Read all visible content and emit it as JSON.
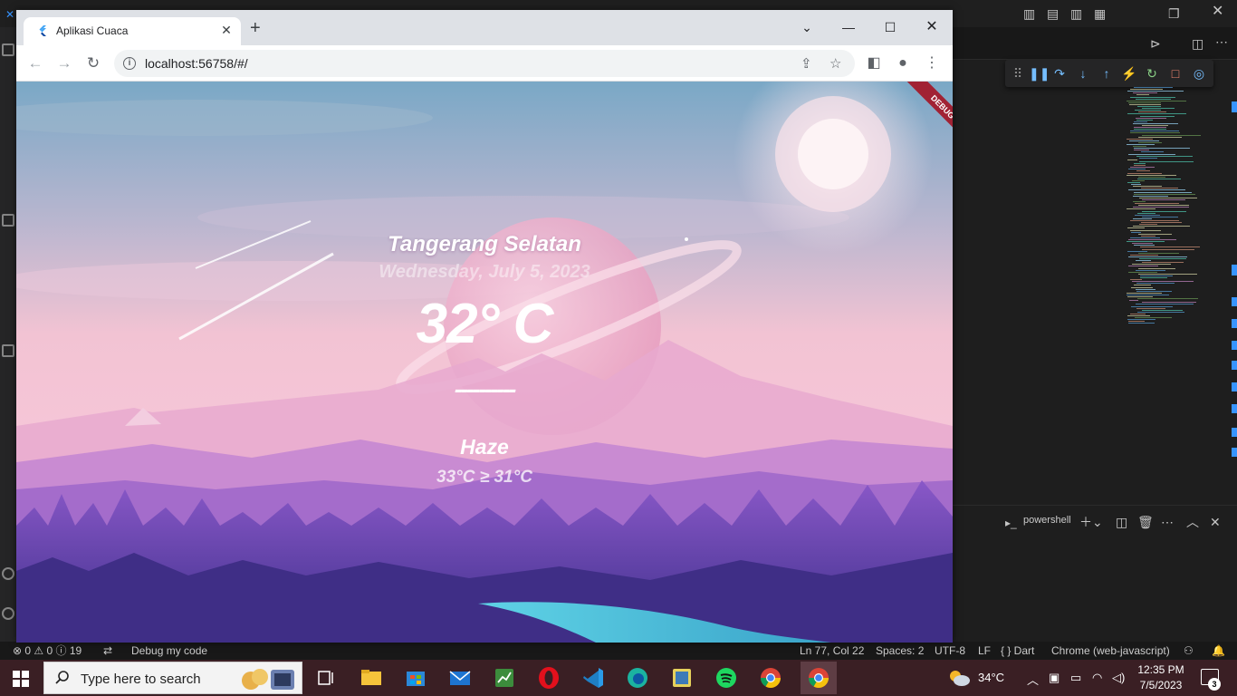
{
  "browser": {
    "tab_title": "Aplikasi Cuaca",
    "url": "localhost:56758/#/"
  },
  "weather": {
    "city": "Tangerang Selatan",
    "date": "Wednesday, July 5, 2023",
    "temperature": "32° C",
    "divider": "----------",
    "condition": "Haze",
    "range": "33°C ≥ 31°C",
    "debug_banner": "DEBUG"
  },
  "vscode": {
    "terminal_label": "powershell",
    "status": {
      "problems": "⊗ 0 ⚠ 0 ⓘ 19",
      "debug_target": "Debug my code",
      "position": "Ln 77, Col 22",
      "spaces": "Spaces: 2",
      "encoding": "UTF-8",
      "eol": "LF",
      "language": "{ } Dart",
      "device": "Chrome (web-javascript)"
    }
  },
  "taskbar": {
    "search_placeholder": "Type here to search",
    "weather_temp": "34°C",
    "time": "12:35 PM",
    "date": "7/5/2023",
    "notification_count": "3"
  },
  "icons": [
    "flutter-icon",
    "back-icon",
    "forward-icon",
    "reload-icon",
    "info-icon",
    "share-icon",
    "star-icon",
    "sidepanel-icon",
    "profile-icon",
    "kebab-icon",
    "windows-start-icon",
    "search-icon",
    "taskview-icon",
    "file-explorer-icon",
    "store-icon",
    "mail-icon",
    "app-icon",
    "opera-icon",
    "vscode-icon",
    "edge-icon",
    "app-icon",
    "spotify-icon",
    "chrome-icon",
    "chrome-icon"
  ],
  "colors": {
    "accent_debug": "#a12234",
    "taskbar": "#3a1f24",
    "vscode_bg": "#1e1e1e"
  }
}
